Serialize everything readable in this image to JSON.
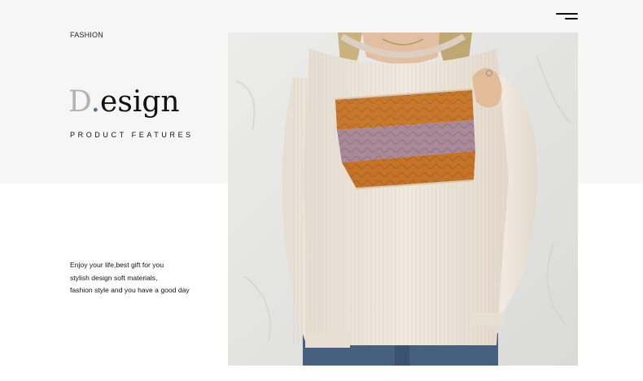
{
  "header": {
    "label": "FASHION",
    "menu_icon": "hamburger-menu-icon"
  },
  "hero": {
    "title_cap": "D",
    "title_dot": ".",
    "title_rest": "esign",
    "subtitle": "PRODUCT FEATURES"
  },
  "body_copy": {
    "lines": [
      "Enjoy your life,best gift for you",
      "stylish design soft materials,",
      "fashion style and you have a good day"
    ]
  },
  "colors": {
    "band": "#f6f6f6",
    "title_dot": "#4f6ea6",
    "sweater_base": "#ece3d8",
    "stripe_orange": "#c8782c",
    "stripe_mauve": "#a98898"
  }
}
